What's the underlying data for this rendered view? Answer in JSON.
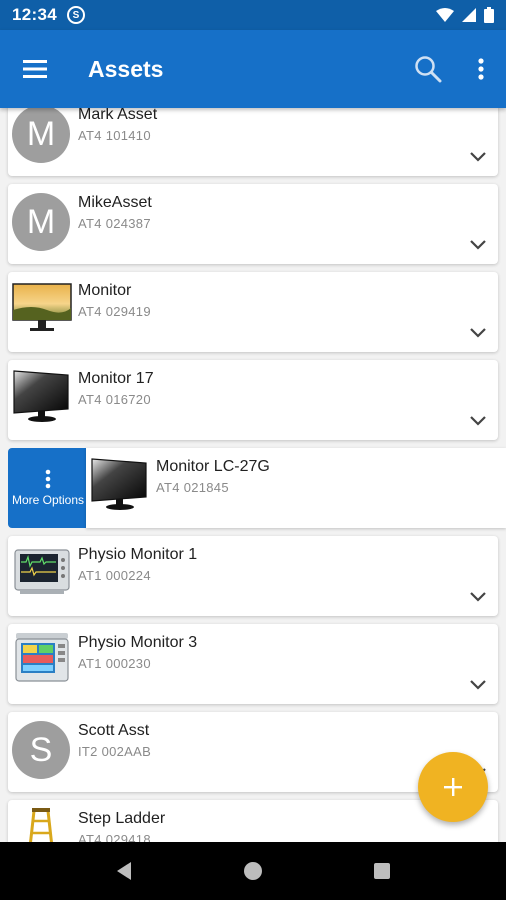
{
  "status_bar": {
    "time": "12:34",
    "left_icon": "sync-icon",
    "right_icons": [
      "wifi-icon",
      "signal-icon",
      "battery-icon"
    ]
  },
  "app_bar": {
    "title": "Assets",
    "menu_icon": "menu-icon",
    "search_icon": "search-icon",
    "overflow_icon": "more-vert-icon"
  },
  "assets": [
    {
      "name": "Mark Asset",
      "code": "AT4 101410",
      "avatar_letter": "M"
    },
    {
      "name": "MikeAsset",
      "code": "AT4 024387",
      "avatar_letter": "M"
    },
    {
      "name": "Monitor",
      "code": "AT4 029419",
      "thumbnail": "landscape-monitor"
    },
    {
      "name": "Monitor 17",
      "code": "AT4 016720",
      "thumbnail": "monitor"
    },
    {
      "name": "Monitor LC-27G",
      "code": "AT4 021845",
      "thumbnail": "monitor"
    },
    {
      "name": "Physio Monitor 1",
      "code": "AT1 000224",
      "thumbnail": "physio-monitor"
    },
    {
      "name": "Physio Monitor 3",
      "code": "AT1 000230",
      "thumbnail": "physio-monitor-color"
    },
    {
      "name": "Scott Asst",
      "code": "IT2 002AAB",
      "avatar_letter": "S"
    },
    {
      "name": "Step Ladder",
      "code": "AT4 029418",
      "thumbnail": "ladder"
    }
  ],
  "swipe_action": {
    "label": "More Options",
    "icon": "more-vert-icon"
  },
  "fab": {
    "label": "+"
  },
  "colors": {
    "primary": "#1670c8",
    "status_bar": "#0f5fa8",
    "fab": "#f0b322",
    "avatar": "#9e9e9e"
  }
}
